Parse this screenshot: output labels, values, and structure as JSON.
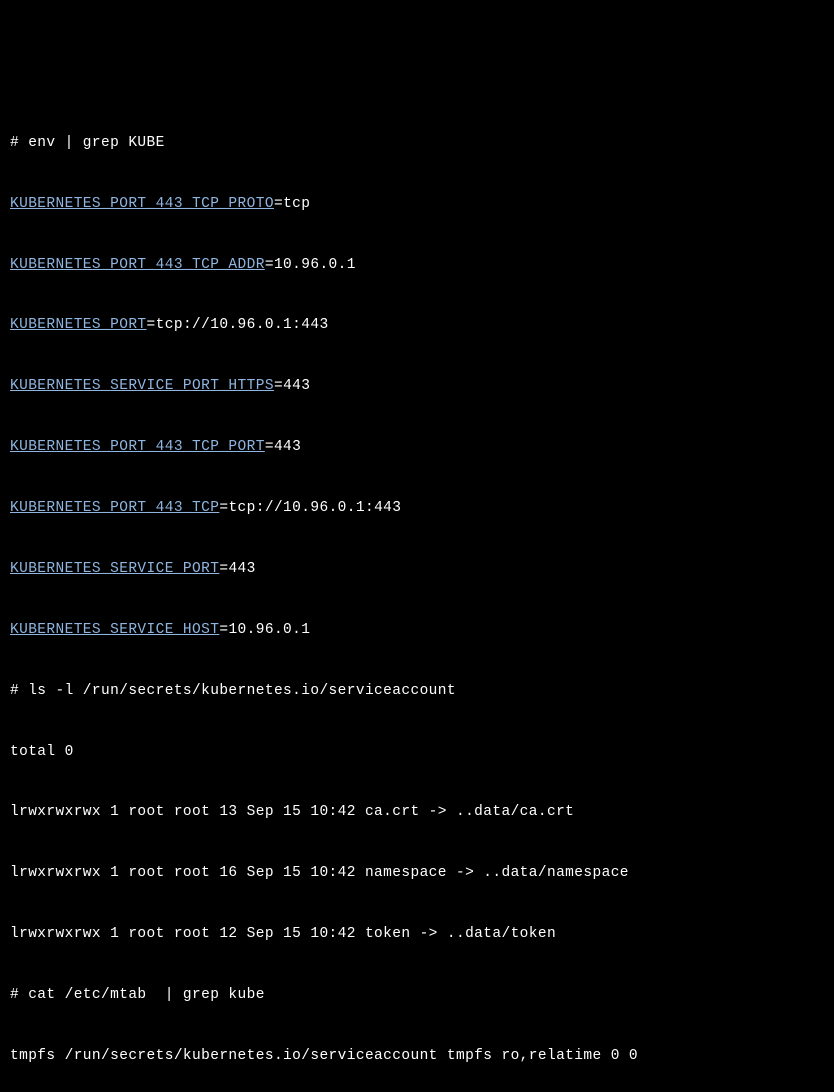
{
  "cmd1": {
    "prompt": "# ",
    "text": "env | grep KUBE"
  },
  "env": [
    {
      "key": "KUBERNETES_PORT_443_TCP_PROTO",
      "val": "tcp"
    },
    {
      "key": "KUBERNETES_PORT_443_TCP_ADDR",
      "val": "10.96.0.1"
    },
    {
      "key": "KUBERNETES_PORT",
      "val": "tcp://10.96.0.1:443"
    },
    {
      "key": "KUBERNETES_SERVICE_PORT_HTTPS",
      "val": "443"
    },
    {
      "key": "KUBERNETES_PORT_443_TCP_PORT",
      "val": "443"
    },
    {
      "key": "KUBERNETES_PORT_443_TCP",
      "val": "tcp://10.96.0.1:443"
    },
    {
      "key": "KUBERNETES_SERVICE_PORT",
      "val": "443"
    },
    {
      "key": "KUBERNETES_SERVICE_HOST",
      "val": "10.96.0.1"
    }
  ],
  "cmd2": {
    "prompt": "# ",
    "text": "ls -l /run/secrets/kubernetes.io/serviceaccount"
  },
  "ls_total": "total 0",
  "ls": [
    "lrwxrwxrwx 1 root root 13 Sep 15 10:42 ca.crt -> ..data/ca.crt",
    "lrwxrwxrwx 1 root root 16 Sep 15 10:42 namespace -> ..data/namespace",
    "lrwxrwxrwx 1 root root 12 Sep 15 10:42 token -> ..data/token"
  ],
  "cmd3": {
    "prompt": "# ",
    "text": "cat /etc/mtab  | grep kube"
  },
  "mtab": "tmpfs /run/secrets/kubernetes.io/serviceaccount tmpfs ro,relatime 0 0"
}
